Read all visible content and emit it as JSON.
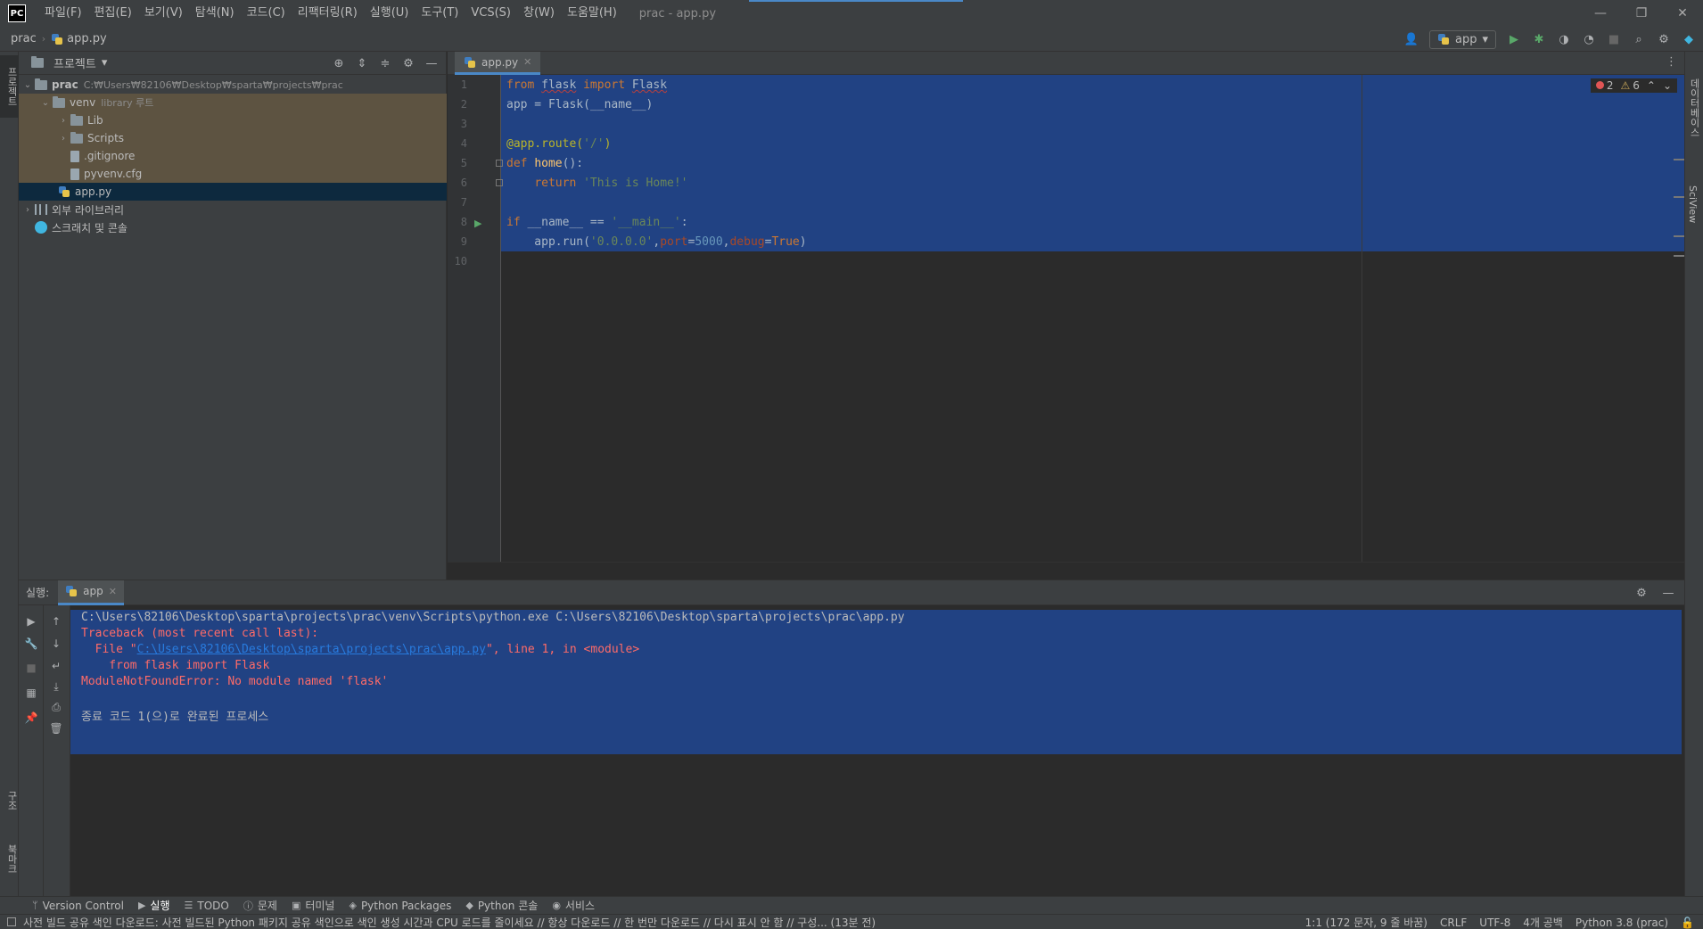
{
  "app": {
    "logo": "PC",
    "window_title": "prac - app.py"
  },
  "menu": [
    "파일(F)",
    "편집(E)",
    "보기(V)",
    "탐색(N)",
    "코드(C)",
    "리팩터링(R)",
    "실행(U)",
    "도구(T)",
    "VCS(S)",
    "창(W)",
    "도움말(H)"
  ],
  "nav": {
    "project": "prac",
    "file": "app.py",
    "run_config": "app"
  },
  "left_strip": {
    "project_tab": "프로젝트",
    "structure_tab": "구조",
    "bookmarks_tab": "북마크"
  },
  "right_strip": {
    "db_tab": "데이터베이스",
    "sciview_tab": "SciView"
  },
  "project_panel": {
    "title": "프로젝트",
    "tree": [
      {
        "label": "prac",
        "hint": "C:₩Users₩82106₩Desktop₩sparta₩projects₩prac"
      },
      {
        "label": "venv",
        "hint": "library 루트"
      },
      {
        "label": "Lib"
      },
      {
        "label": "Scripts"
      },
      {
        "label": ".gitignore"
      },
      {
        "label": "pyvenv.cfg"
      },
      {
        "label": "app.py"
      },
      {
        "label": "외부 라이브러리"
      },
      {
        "label": "스크래치 및 콘솔"
      }
    ]
  },
  "editor": {
    "tab": "app.py",
    "line_numbers": [
      "1",
      "2",
      "3",
      "4",
      "5",
      "6",
      "7",
      "8",
      "9",
      "10"
    ],
    "inspections": {
      "errors": "2",
      "warnings": "6"
    }
  },
  "run_panel": {
    "label": "실행:",
    "tab": "app",
    "lines": {
      "cmd": "C:\\Users\\82106\\Desktop\\sparta\\projects\\prac\\venv\\Scripts\\python.exe C:\\Users\\82106\\Desktop\\sparta\\projects\\prac\\app.py",
      "traceback": "Traceback (most recent call last):",
      "file_prefix": "  File \"",
      "file_link": "C:\\Users\\82106\\Desktop\\sparta\\projects\\prac\\app.py",
      "file_suffix": "\", line 1, in <module>",
      "code": "    from flask import Flask",
      "error": "ModuleNotFoundError: No module named 'flask'",
      "exit": "종료 코드 1(으)로 완료된 프로세스"
    }
  },
  "bottom_tools": [
    "Version Control",
    "실행",
    "TODO",
    "문제",
    "터미널",
    "Python Packages",
    "Python 콘솔",
    "서비스"
  ],
  "status": {
    "message": "사전 빌드 공유 색인 다운로드: 사전 빌드된 Python 패키지 공유 색인으로 색인 생성 시간과 CPU 로드를 줄이세요 // 항상 다운로드 // 한 번만 다운로드 // 다시 표시 안 함 // 구성... (13분 전)",
    "position": "1:1 (172 문자, 9 줄 바꿈)",
    "line_sep": "CRLF",
    "encoding": "UTF-8",
    "indent": "4개 공백",
    "interpreter": "Python 3.8 (prac)"
  },
  "colors": {
    "accent": "#4a88c7",
    "selection": "#214283",
    "error_text": "#ff6b68",
    "keyword": "#cc7832",
    "string": "#6a8759"
  }
}
